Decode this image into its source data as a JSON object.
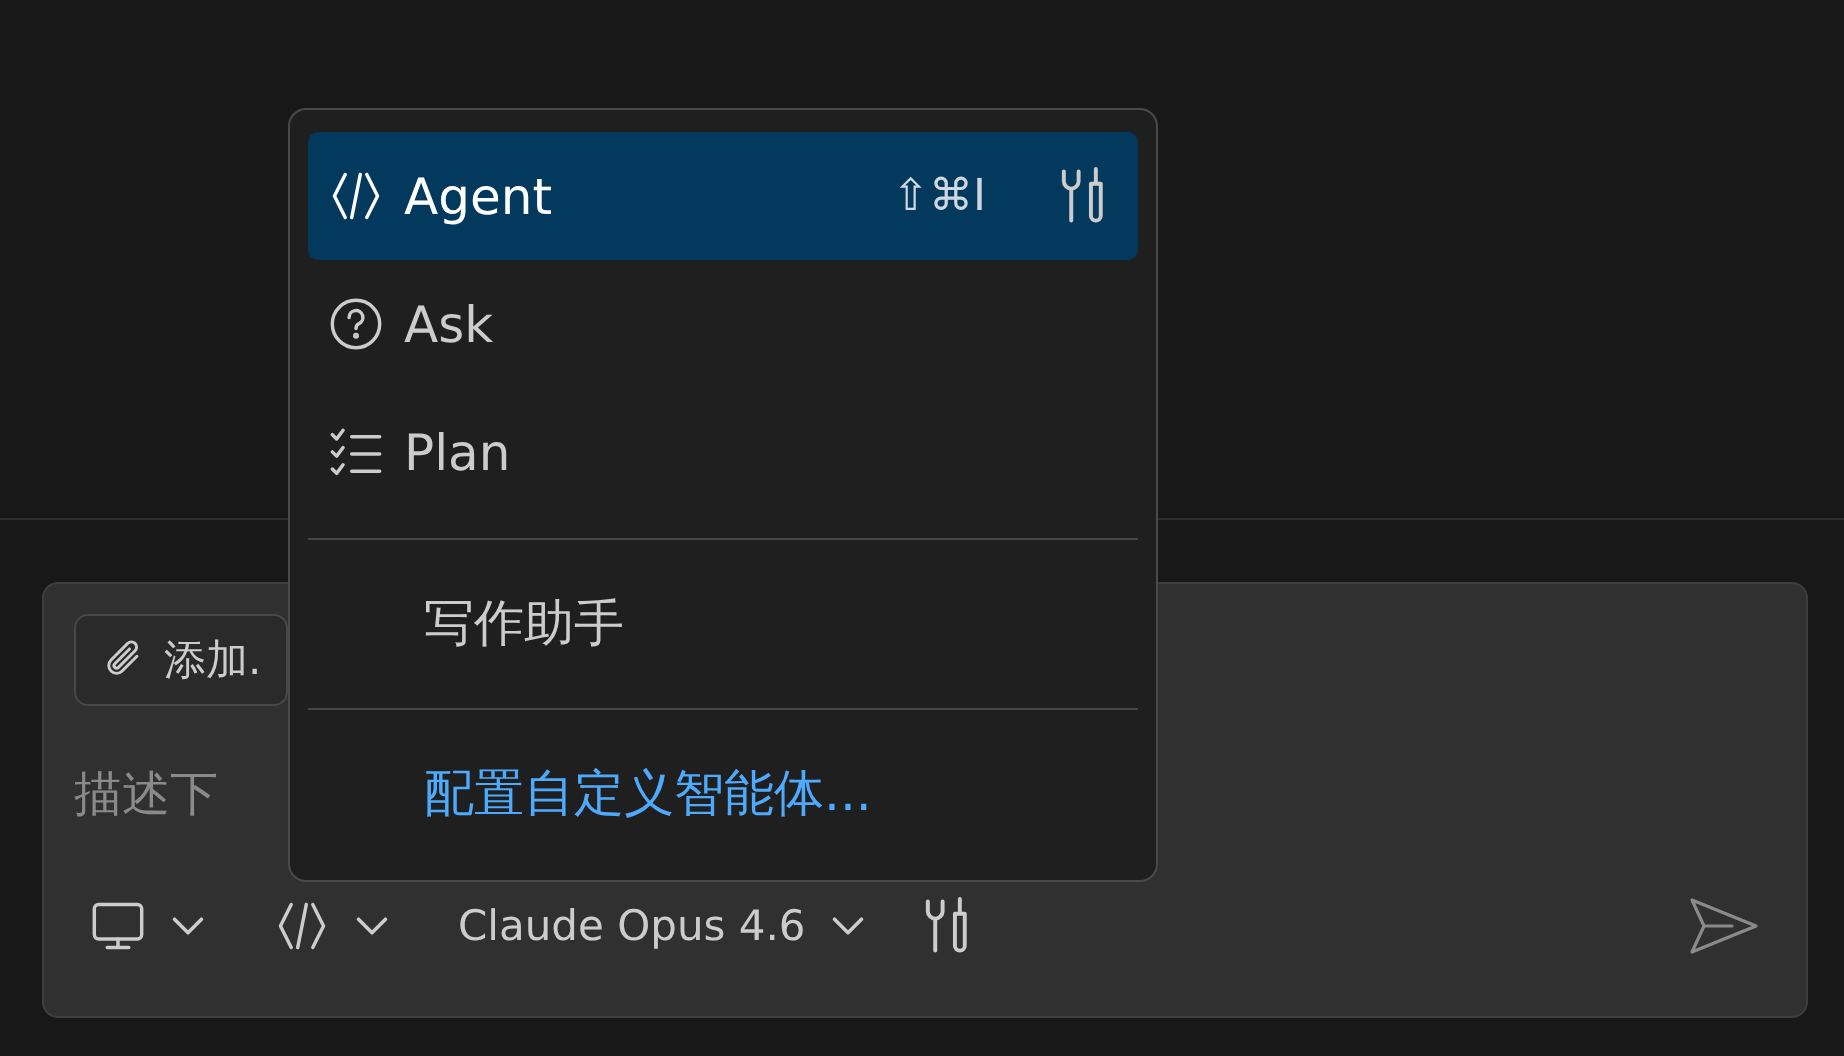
{
  "composer": {
    "attach_label": "添加.",
    "placeholder": "描述下",
    "model": "Claude Opus 4.6"
  },
  "mode_menu": {
    "items": [
      {
        "kind": "mode",
        "label": "Agent",
        "selected": true,
        "shortcut": "⇧⌘I"
      },
      {
        "kind": "mode",
        "label": "Ask",
        "selected": false
      },
      {
        "kind": "mode",
        "label": "Plan",
        "selected": false
      },
      {
        "kind": "divider"
      },
      {
        "kind": "plain",
        "label": "写作助手"
      },
      {
        "kind": "divider"
      },
      {
        "kind": "link",
        "label": "配置自定义智能体..."
      }
    ]
  }
}
